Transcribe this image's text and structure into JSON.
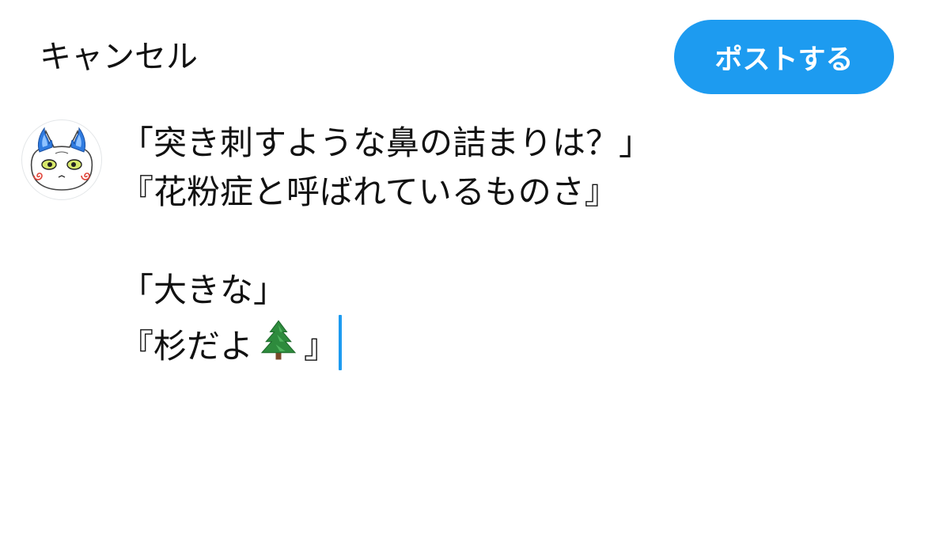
{
  "header": {
    "cancel_label": "キャンセル",
    "post_label": "ポストする",
    "post_color": "#1d9bf0"
  },
  "composer": {
    "lines": [
      "「突き刺すような鼻の詰まりは？」",
      "『花粉症と呼ばれているものさ』",
      "",
      "「大きな」",
      "『杉だよ",
      "』"
    ],
    "emoji_icon": "evergreen-tree-icon",
    "caret_color": "#1d9bf0"
  }
}
